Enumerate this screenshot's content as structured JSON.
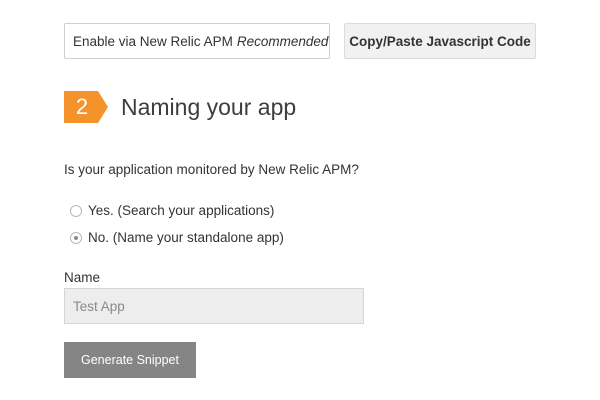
{
  "method_options": {
    "apm_label": "Enable via New Relic APM",
    "apm_tag": "Recommended",
    "copy_label": "Copy/Paste Javascript Code"
  },
  "step": {
    "number": "2",
    "title": "Naming your app",
    "badge_color": "#f5922b"
  },
  "question": "Is your application monitored by New Relic APM?",
  "options": [
    {
      "label": "Yes. (Search your applications)",
      "selected": false
    },
    {
      "label": "No. (Name your standalone app)",
      "selected": true
    }
  ],
  "name_field": {
    "label": "Name",
    "value": "Test App"
  },
  "generate_button": {
    "label": "Generate Snippet",
    "color": "#858585"
  }
}
